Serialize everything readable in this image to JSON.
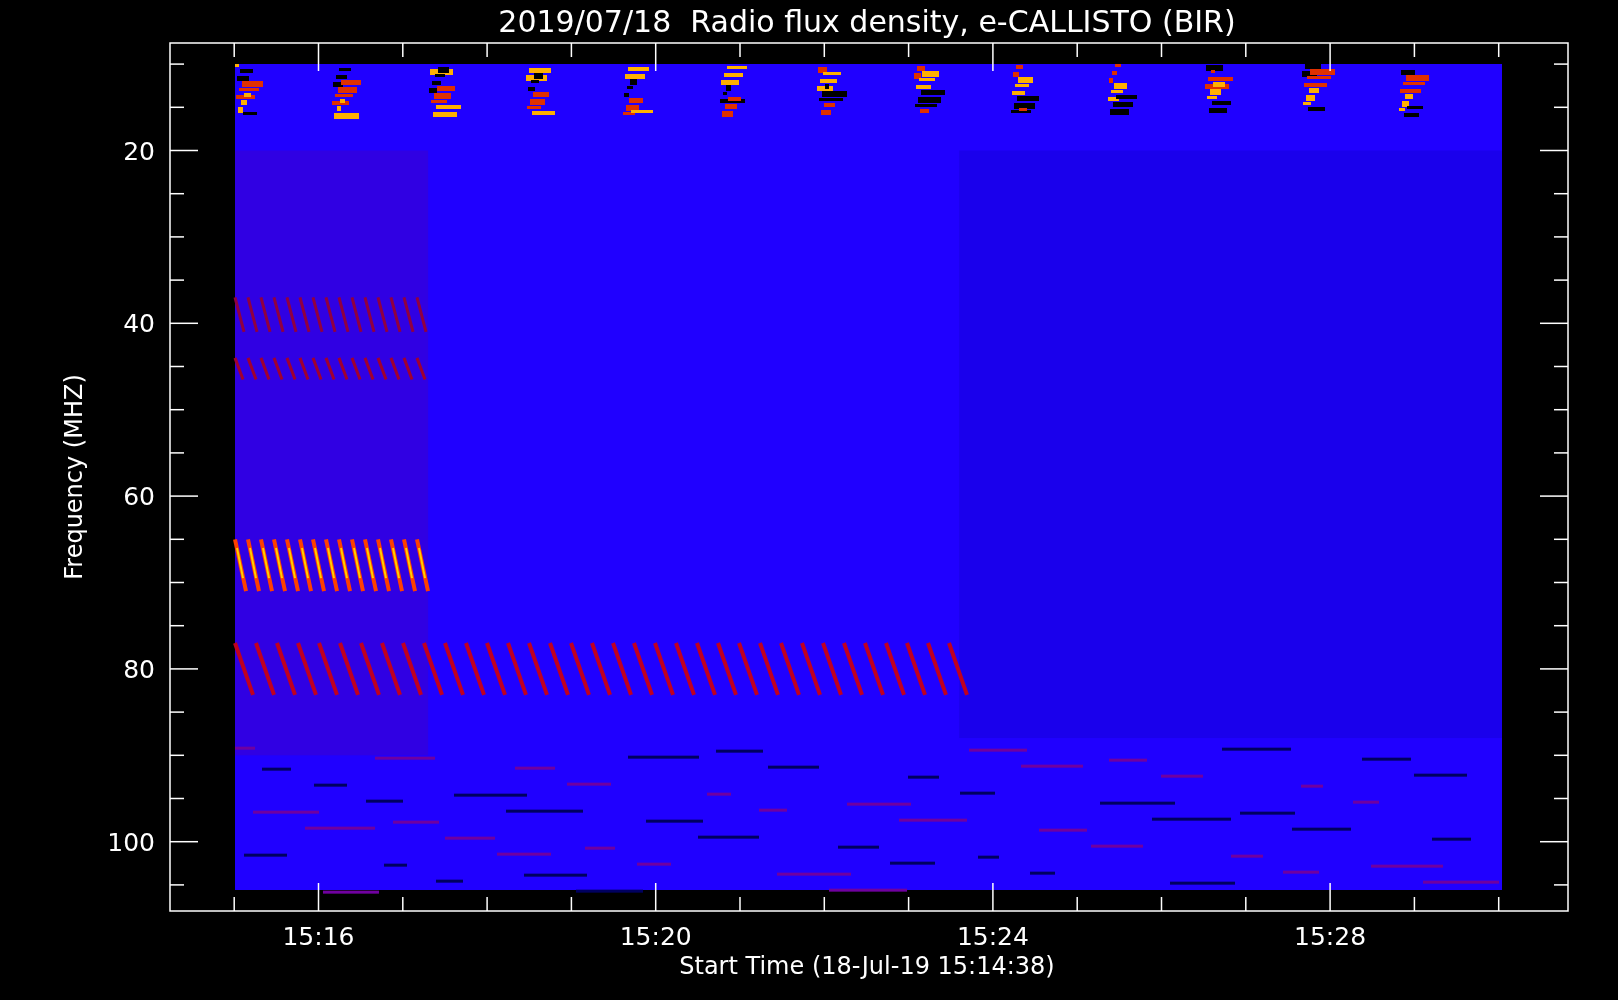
{
  "title": "2019/07/18  Radio flux density, e-CALLISTO (BIR)",
  "y_axis": {
    "label": "Frequency (MHZ)",
    "ticks": [
      "20",
      "40",
      "60",
      "80",
      "100"
    ]
  },
  "x_axis": {
    "label": "Start Time (18-Jul-19 15:14:38)",
    "ticks": [
      "15:16",
      "15:20",
      "15:24",
      "15:28"
    ]
  }
}
